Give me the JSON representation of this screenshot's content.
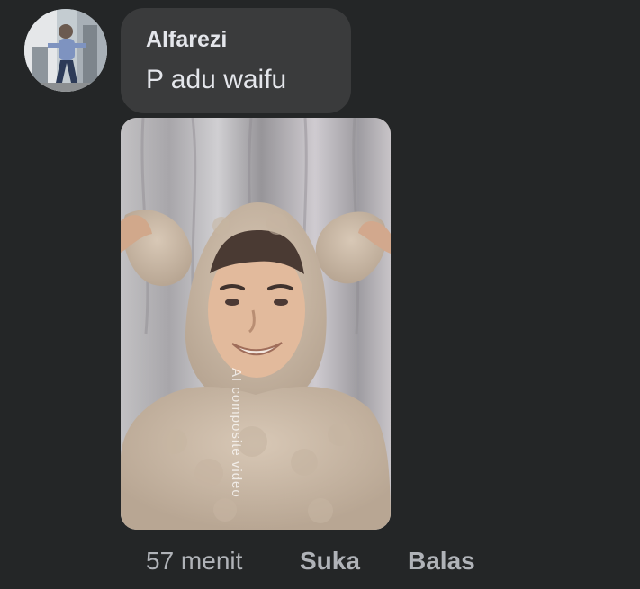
{
  "comment": {
    "author": "Alfarezi",
    "text": "P adu waifu",
    "avatar_icon": "user-avatar-photo"
  },
  "media": {
    "watermark": "AI composite video",
    "icon": "attached-photo"
  },
  "actions": {
    "time": "57 menit",
    "like": "Suka",
    "reply": "Balas"
  },
  "colors": {
    "background": "#242627",
    "bubble": "#3a3b3c",
    "text_primary": "#e4e6eb",
    "text_secondary": "#b0b3b8"
  }
}
